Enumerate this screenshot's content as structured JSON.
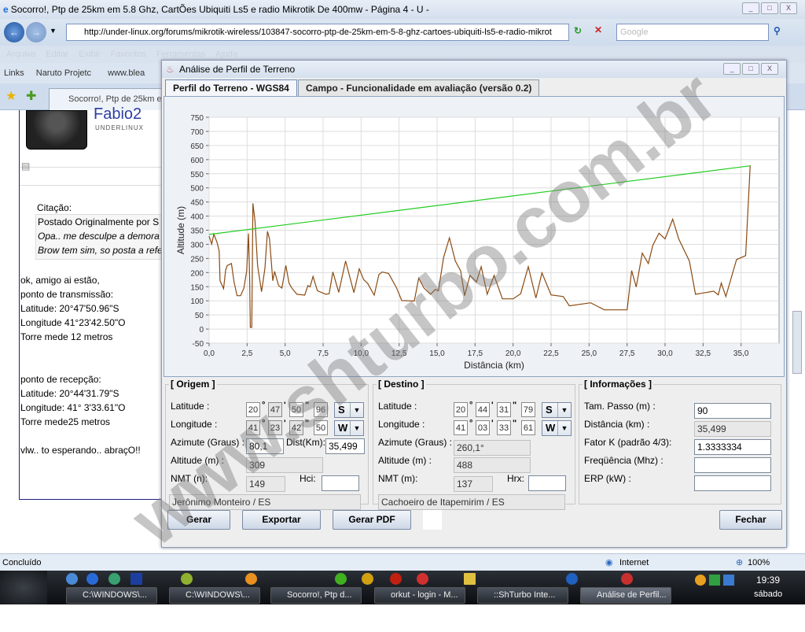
{
  "browser": {
    "title": "Socorro!, Ptp de 25km em 5.8 Ghz, CartÕes Ubiquiti Ls5 e radio Mikrotik De 400mw - Página 4 - U -",
    "url": "http://under-linux.org/forums/mikrotik-wireless/103847-socorro-ptp-de-25km-em-5-8-ghz-cartoes-ubiquiti-ls5-e-radio-mikrot",
    "search_placeholder": "Google",
    "menu": [
      "Arquivo",
      "Editar",
      "Exibir",
      "Favoritos",
      "Ferramentas",
      "Ajuda"
    ],
    "links_label": "Links",
    "links": [
      "Naruto Projetc",
      "www.blea"
    ],
    "tab_label": "Socorro!, Ptp de 25km em",
    "status": "Concluído",
    "zone": "Internet",
    "zoom": "100%"
  },
  "post": {
    "username": "Fabio2",
    "rank": "UNDERLINUX",
    "quote_label": "Citação:",
    "quote_by": "Postado Originalmente por S",
    "quote_lines": [
      "Opa.. me desculpe a demora",
      "Brow tem sim, so posta a refe"
    ],
    "lines": [
      "ok, amigo ai estão,",
      "",
      "ponto de transmissão:",
      "Latitude: 20°47'50.96\"S",
      "Longitude 41°23'42.50\"O",
      "Torre mede 12 metros",
      "",
      "",
      "ponto de recepção:",
      "Latitude: 20°44'31.79\"S",
      "Longitude: 41° 3'33.61\"O",
      "Torre mede25 metros",
      "",
      "vlw.. to esperando.. abraçO!!"
    ]
  },
  "dialog": {
    "title": "Análise de Perfil de Terreno",
    "tabs": [
      "Perfil do Terreno - WGS84",
      "Campo - Funcionalidade em avaliação (versão 0.2)"
    ],
    "origem": {
      "legend": "[ Origem ]",
      "lat_label": "Latitude :",
      "lat": [
        "20",
        "47",
        "50",
        "96"
      ],
      "lat_hem": "S",
      "lon_label": "Longitude :",
      "lon": [
        "41",
        "23",
        "42",
        "50"
      ],
      "lon_hem": "W",
      "az_label": "Azimute (Graus) :",
      "az": "80,1",
      "dist_label": "Dist(Km):",
      "dist": "35,499",
      "alt_label": "Altitude (m) :",
      "alt": "309",
      "nmt_label": "NMT (n):",
      "nmt": "149",
      "h_label": "Hci:",
      "h": "",
      "place": "Jerônimo Monteiro / ES"
    },
    "destino": {
      "legend": "[ Destino ]",
      "lat_label": "Latitude :",
      "lat": [
        "20",
        "44",
        "31",
        "79"
      ],
      "lat_hem": "S",
      "lon_label": "Longitude :",
      "lon": [
        "41",
        "03",
        "33",
        "61"
      ],
      "lon_hem": "W",
      "az_label": "Azimute (Graus) :",
      "az": "260,1°",
      "alt_label": "Altitude (m) :",
      "alt": "488",
      "nmt_label": "NMT (m):",
      "nmt": "137",
      "h_label": "Hrx:",
      "h": "",
      "place": "Cachoeiro de Itapemirim / ES"
    },
    "info": {
      "legend": "[ Informações ]",
      "passo_label": "Tam. Passo (m) :",
      "passo": "90",
      "dist_label": "Distância (km) :",
      "dist": "35,499",
      "k_label": "Fator K (padrão 4/3):",
      "k": "1.3333334",
      "freq_label": "Freqüência (Mhz) :",
      "freq": "",
      "erp_label": "ERP (kW) :",
      "erp": ""
    },
    "buttons": {
      "gerar": "Gerar",
      "exportar": "Exportar",
      "pdf": "Gerar PDF",
      "fechar": "Fechar"
    }
  },
  "taskbar": {
    "buttons": [
      "C:\\WINDOWS\\...",
      "C:\\WINDOWS\\...",
      "Socorro!, Ptp d...",
      "orkut - login - M...",
      "::ShTurbo Inte...",
      "Análise de Perfil..."
    ],
    "time": "19:39",
    "day": "sábado"
  },
  "watermark": "www.shturbo.com.br",
  "colors": {
    "terrain": "#8b4a12",
    "los": "#22cc22",
    "accent": "#1a237e"
  },
  "chart_data": {
    "type": "line",
    "xlabel": "Distância (km)",
    "ylabel": "Altitude (m)",
    "xlim": [
      0,
      37.5
    ],
    "ylim": [
      -50,
      750
    ],
    "xticks": [
      "0,0",
      "2,5",
      "5,0",
      "7,5",
      "10,0",
      "12,5",
      "15,0",
      "17,5",
      "20,0",
      "22,5",
      "25,0",
      "27,5",
      "30,0",
      "32,5",
      "35,0"
    ],
    "yticks": [
      750,
      700,
      650,
      600,
      550,
      500,
      450,
      400,
      350,
      300,
      250,
      200,
      150,
      100,
      50,
      0,
      -50
    ],
    "grid": true,
    "series": [
      {
        "name": "terrain",
        "x": [
          0,
          0.17,
          0.31,
          0.52,
          0.66,
          0.72,
          0.95,
          1.09,
          1.2,
          1.47,
          1.64,
          1.84,
          2.07,
          2.29,
          2.47,
          2.59,
          2.67,
          2.71,
          2.81,
          2.88,
          3.02,
          3.19,
          3.45,
          3.67,
          3.84,
          3.97,
          4.19,
          4.31,
          4.57,
          4.79,
          5.05,
          5.26,
          5.43,
          5.78,
          6.29,
          6.5,
          6.64,
          6.84,
          7.12,
          7.67,
          7.9,
          8.14,
          8.53,
          8.98,
          9.53,
          9.88,
          10.17,
          10.43,
          10.86,
          11.17,
          11.38,
          11.81,
          12.33,
          12.67,
          13.5,
          13.79,
          14.14,
          14.57,
          14.88,
          15.09,
          15.43,
          15.81,
          16.2,
          16.55,
          16.81,
          17.16,
          17.59,
          17.9,
          18.3,
          18.75,
          19.3,
          20.0,
          20.5,
          21.0,
          21.5,
          21.9,
          22.5,
          23.3,
          23.7,
          25.1,
          26.0,
          27.5,
          27.8,
          28.1,
          28.5,
          28.9,
          29.2,
          29.6,
          30.0,
          30.5,
          30.9,
          31.6,
          32.0,
          33.2,
          33.5,
          33.7,
          34.0,
          34.7,
          35.3,
          35.6
        ],
        "y": [
          329,
          301,
          336,
          307,
          276,
          171,
          143,
          210,
          225,
          232,
          167,
          118,
          118,
          145,
          206,
          338,
          175,
          6,
          6,
          445,
          382,
          224,
          132,
          215,
          346,
          320,
          171,
          204,
          154,
          145,
          225,
          162,
          146,
          123,
          120,
          154,
          149,
          186,
          136,
          123,
          125,
          202,
          130,
          241,
          129,
          213,
          175,
          162,
          120,
          193,
          202,
          197,
          146,
          101,
          99,
          180,
          145,
          123,
          140,
          136,
          254,
          323,
          241,
          206,
          118,
          190,
          167,
          221,
          123,
          190,
          107,
          107,
          125,
          221,
          110,
          199,
          121,
          115,
          82,
          93,
          68,
          68,
          207,
          149,
          269,
          232,
          297,
          339,
          319,
          389,
          319,
          241,
          123,
          134,
          121,
          163,
          115,
          246,
          260,
          580
        ]
      },
      {
        "name": "line-of-sight",
        "x": [
          0,
          35.6
        ],
        "y": [
          335,
          578
        ]
      }
    ]
  }
}
